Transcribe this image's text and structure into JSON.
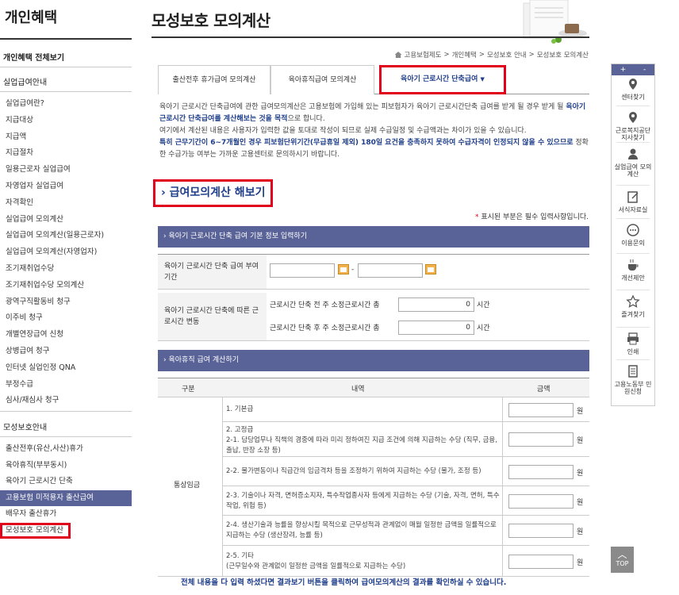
{
  "sidebar": {
    "title": "개인혜택",
    "all_view": "개인혜택 전체보기",
    "section1": "실업급여안내",
    "items1": [
      "실업급여란?",
      "지급대상",
      "지급액",
      "지급절차",
      "일용근로자 실업급여",
      "자영업자 실업급여",
      "자격확인",
      "실업급여 모의계산",
      "실업급여 모의계산(일용근로자)",
      "실업급여 모의계산(자영업자)",
      "조기재취업수당",
      "조기재취업수당 모의계산",
      "광역구직활동비 청구",
      "이주비 청구",
      "개별연장급여 신청",
      "상병급여 청구",
      "인터넷 실업인정 QNA",
      "부정수급",
      "심사/재심사 청구"
    ],
    "section2": "모성보호안내",
    "items2": [
      "출산전후(유산,사산)휴가",
      "육아휴직(부부동시)",
      "육아기 근로시간 단축",
      "고용보험 미적용자 출산급여",
      "배우자 출산휴가",
      "모성보호 모의계산"
    ]
  },
  "header": {
    "title": "모성보호 모의계산",
    "breadcrumb": [
      "고용보험제도",
      "개인혜택",
      "모성보호 안내",
      "모성보호 모의계산"
    ]
  },
  "tabs": [
    "출산전후 휴가급여 모의계산",
    "육아휴직급여 모의계산",
    "육아기 근로시간 단축급여"
  ],
  "intro": {
    "p1a": "육아기 근로시간 단축급여에 관한 급여모의계산은 고용보험에 가입해 있는 피보험자가 육아기 근로시간단축 급여를 받게 될 경우 받게 될 ",
    "p1b": "육아기 근로시간 단축급여를 계산해보는 것을 목적",
    "p1c": "으로 합니다.",
    "p2": "여기에서 계산된 내용은 사용자가 입력한 값을 토대로 작성이 되므로 실제 수급일정 및 수급액과는 차이가 있을 수 있습니다.",
    "p3a": "특히 근무기간이 6~7개월인 경우 피보험단위기간(무급휴일 제외) 180일 요건을 충족하지 못하여 수급자격이 인정되지 않을 수 있으므로",
    "p3b": " 정확한 수급가능 여부는 가까운 고용센터로 문의하시기 바랍니다."
  },
  "calc_heading": "급여모의계산 해보기",
  "required_note_star": "*",
  "required_note": " 표시된 부분은 필수 입력사항입니다.",
  "section_basic": {
    "band": "육아기 근로시간 단축 급여 기본 정보 입력하기",
    "period_label": "육아기 근로시간 단축 급여 부여기간",
    "date_sep": "-",
    "change_label": "육아기 근로시간 단축에 따른 근로시간 변동",
    "before_label": "근로시간 단축 전 주 소정근로시간 총",
    "after_label": "근로시간 단축 후 주 소정근로시간 총",
    "before_value": "0",
    "after_value": "0",
    "unit": "시간"
  },
  "section_wage": {
    "band": "육아휴직 급여 계산하기",
    "col_type": "구분",
    "col_detail": "내역",
    "col_amount": "금액",
    "row_group": "통상임금",
    "rows": [
      "1. 기본급",
      "2. 고정급\n2-1. 담당업무나 직책의 경중에 따라 미리 정하여진 지급 조건에 의해 지급하는 수당 (직무, 금융, 출납, 반장 소장 등)",
      "2-2. 물가변동이나 직급간의 임금격차 등을 조정하기 위하여 지급하는 수당 (물가, 조정 등)",
      "2-3. 기술이나 자격, 면허증소지자, 특수작업종사자 등에게 지급하는 수당 (기술, 자격, 면허, 특수작업, 위험 등)",
      "2-4. 생산기술과 능률을 향상시킬 목적으로 근무성적과 관계없이 매월 일정한 금액을 일률적으로 지급하는 수당 (생산장려, 능률 등)",
      "2-5. 기타\n(근무일수와 관계없이 일정한 금액을 일률적으로 지급하는 수당)"
    ],
    "won": "원"
  },
  "bottom_note": "전체 내용을 다 입력 하셨다면 결과보기 버튼을 클릭하여 급여모의계산의 결과를 확인하실 수 있습니다.",
  "quick_menu": {
    "arrows": [
      "+",
      "-"
    ],
    "items": [
      "센터찾기",
      "근로복지공단 지사찾기",
      "실업급여 모의계산",
      "서식자료실",
      "이용문의",
      "개선제안",
      "즐겨찾기",
      "인쇄",
      "고용노동부 민원신청"
    ]
  },
  "top_button": "TOP",
  "colors": {
    "band": "#5a6397",
    "highlight_red": "#e0001b",
    "accent_blue": "#1f3e8a"
  }
}
